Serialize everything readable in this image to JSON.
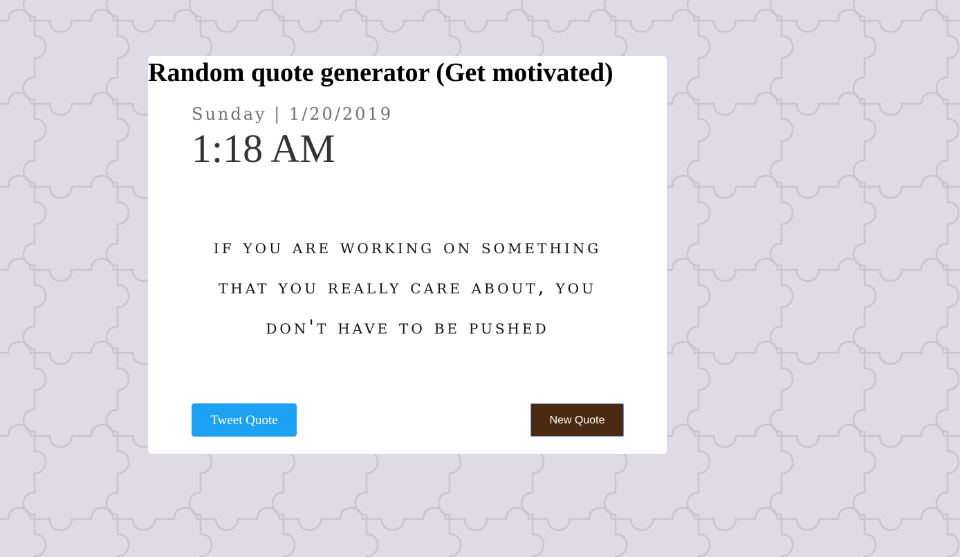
{
  "page": {
    "background_color": "#dedbe6",
    "pattern_color": "#c8c3d1",
    "background_pattern": "puzzle-pieces"
  },
  "card": {
    "title": "Random quote generator (Get motivated)",
    "date_line": "Sunday | 1/20/2019",
    "time": "1:18 AM",
    "quote": "IF YOU ARE WORKING ON SOMETHING THAT YOU REALLY CARE ABOUT, YOU DON'T HAVE TO BE PUSHED"
  },
  "buttons": {
    "tweet_label": "Tweet Quote",
    "tweet_color": "#1da1f2",
    "new_label": "New Quote",
    "new_color": "#4a2a12"
  }
}
